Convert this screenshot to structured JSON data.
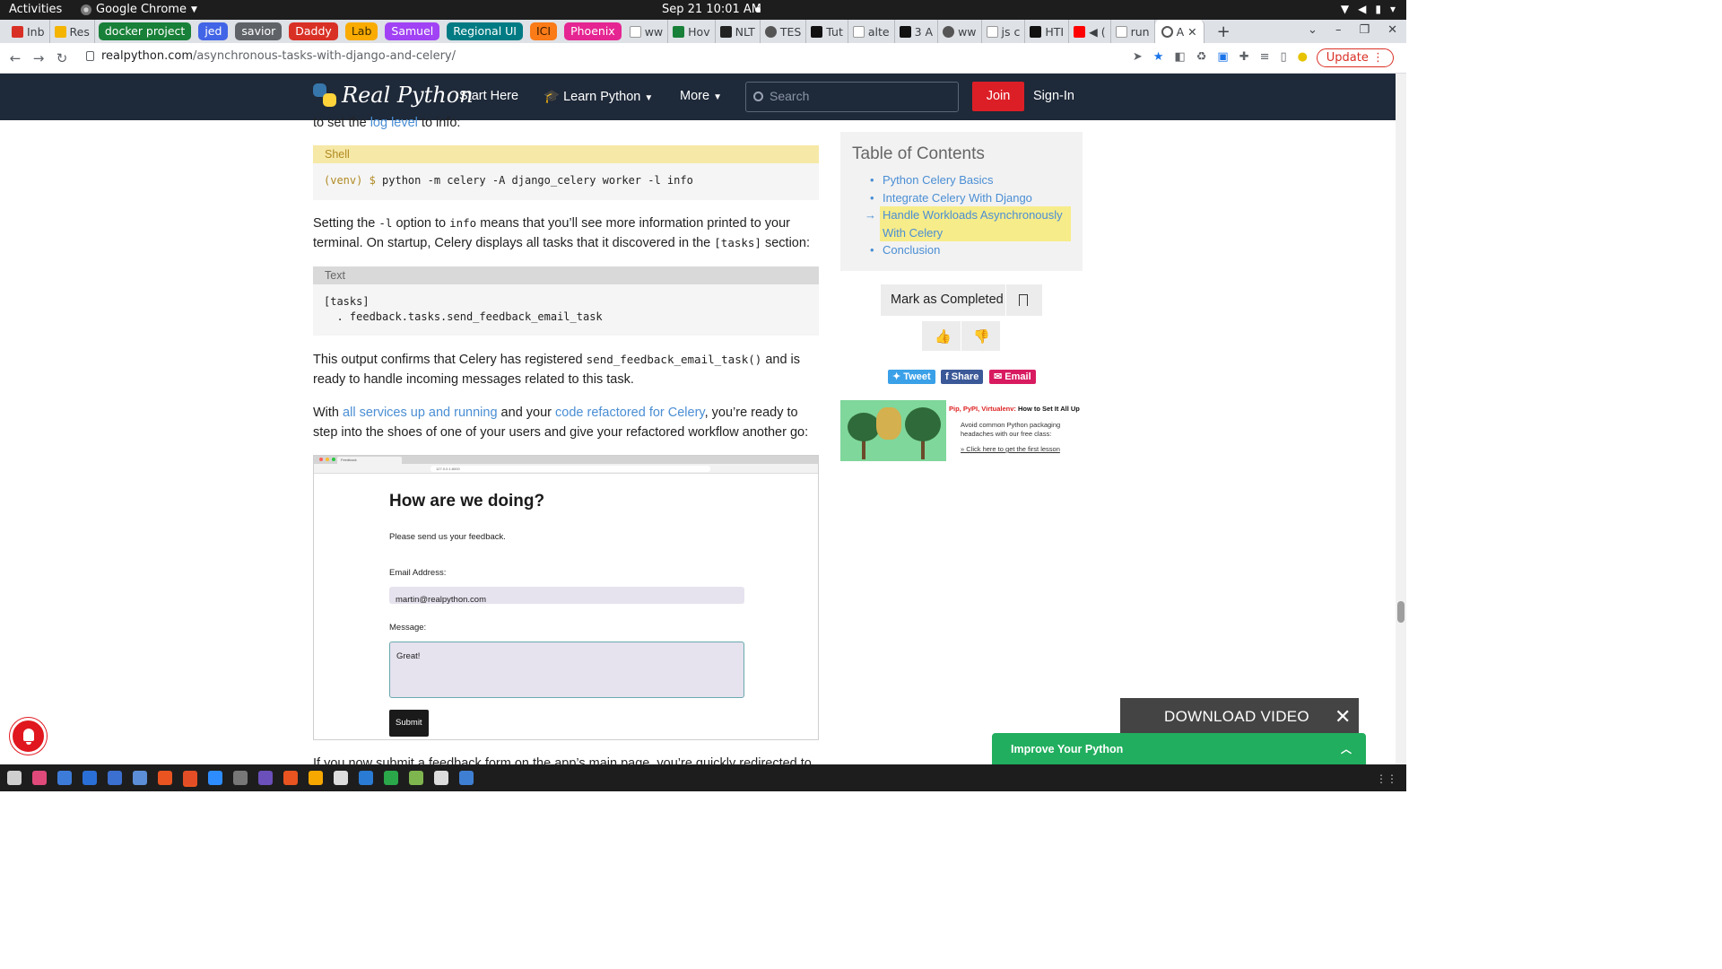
{
  "system": {
    "activities": "Activities",
    "app_name": "Google Chrome",
    "clock": "Sep 21  10:01 AM"
  },
  "tabs": {
    "pinned": [
      {
        "label": "Inb",
        "color": "#d93025"
      },
      {
        "label": "Res",
        "color": "#1a73e8"
      }
    ],
    "groups": [
      {
        "label": "docker project",
        "color": "#188038"
      },
      {
        "label": "jed",
        "color": "#4264e6"
      },
      {
        "label": "savior",
        "color": "#5f6368"
      },
      {
        "label": "Daddy",
        "color": "#d93025"
      },
      {
        "label": "Lab",
        "color": "#f9ab00"
      },
      {
        "label": "Samuel",
        "color": "#a142f4"
      },
      {
        "label": "Regional UI",
        "color": "#007b83"
      },
      {
        "label": "ICI",
        "color": "#fa7b17"
      },
      {
        "label": "Phoenix",
        "color": "#e52592"
      }
    ],
    "regular": [
      "ww",
      "Hov",
      "NLT",
      "TES",
      "Tut",
      "alte",
      "3 A",
      "ww",
      "js c",
      "HTI",
      "(",
      "run"
    ],
    "active": "A"
  },
  "address_bar": {
    "domain": "realpython.com",
    "path": "/asynchronous-tasks-with-django-and-celery/",
    "update_label": "Update"
  },
  "site_nav": {
    "logo": "Real Python",
    "start_here": "Start Here",
    "learn_python": "Learn Python",
    "more": "More",
    "search_placeholder": "Search",
    "join": "Join",
    "sign_in": "Sign-In"
  },
  "article": {
    "cut_line_pre": "to set the ",
    "cut_line_link": "log level",
    "cut_line_post": " to info:",
    "shell_block": {
      "label": "Shell",
      "prompt": "(venv) $ ",
      "command": "python -m celery -A django_celery worker -l info"
    },
    "para1_a": "Setting the ",
    "para1_code1": "-l",
    "para1_b": " option to ",
    "para1_code2": "info",
    "para1_c": " means that you’ll see more information printed to your terminal. On startup, Celery displays all tasks that it discovered in the ",
    "para1_code3": "[tasks]",
    "para1_d": " section:",
    "text_block": {
      "label": "Text",
      "line1": "[tasks]",
      "line2": "  . feedback.tasks.send_feedback_email_task"
    },
    "para2_a": "This output confirms that Celery has registered ",
    "para2_code": "send_feedback_email_task()",
    "para2_b": " and is ready to handle incoming messages related to this task.",
    "para3_a": "With ",
    "para3_link1": "all services up and running",
    "para3_b": " and your ",
    "para3_link2": "code refactored for Celery",
    "para3_c": ", you’re ready to step into the shoes of one of your users and give your refactored workflow another go:",
    "embed": {
      "tab_title": "Feedback",
      "url": "127.0.0.1:8000",
      "heading": "How are we doing?",
      "subheading": "Please send us your feedback.",
      "email_label": "Email Address:",
      "email_value": "martin@realpython.com",
      "message_label": "Message:",
      "message_value": "Great!",
      "submit_label": "Submit"
    },
    "cut_bottom": "If you now submit a feedback form on the app’s main page, you’re quickly redirected to the"
  },
  "toc": {
    "title": "Table of Contents",
    "items": [
      {
        "label": "Python Celery Basics"
      },
      {
        "label": "Integrate Celery With Django"
      },
      {
        "label": "Handle Workloads Asynchronously With Celery"
      },
      {
        "label": "Conclusion"
      }
    ]
  },
  "sidebar": {
    "mark_completed": "Mark as Completed",
    "share": {
      "tweet": "Tweet",
      "share": "Share",
      "email": "Email"
    },
    "ad": {
      "title_red": "Pip, PyPI, Virtualenv:",
      "title_rest": " How to Set It All Up",
      "body": "Avoid common Python packaging headaches with our free class:",
      "cta": "» Click here to get the first lesson"
    }
  },
  "overlays": {
    "download_video": "DOWNLOAD VIDEO",
    "improve_python": "Improve Your Python"
  },
  "taskbar": {
    "icon_colors": [
      "#cfcfcf",
      "#e04a7a",
      "#3d7bd9",
      "#2a6fd6",
      "#3b6fd0",
      "#5b8ed6",
      "#e95420",
      "#e34e26",
      "#2d8cff",
      "#777777",
      "#6b4fbb",
      "#e95420",
      "#f6a800",
      "#dddddd",
      "#2a7bd3",
      "#2aa84a",
      "#7fb54e",
      "#dddddd",
      "#3f7fd3"
    ]
  }
}
